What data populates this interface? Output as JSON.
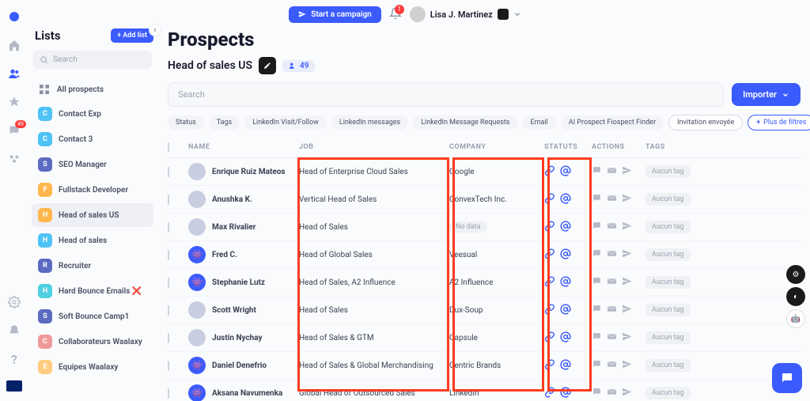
{
  "topbar": {
    "start_campaign": "Start a campaign",
    "notif_count": "1",
    "user_name": "Lisa J. Martinez"
  },
  "sidebar_nav": {
    "msgs_badge": "49"
  },
  "lists": {
    "title": "Lists",
    "add": "+  Add list",
    "search_placeholder": "Search",
    "all_prospects": "All prospects",
    "items": [
      {
        "initial": "C",
        "color": "#4fc3f7",
        "label": "Contact Exp"
      },
      {
        "initial": "C",
        "color": "#4fc3f7",
        "label": "Contact 3"
      },
      {
        "initial": "S",
        "color": "#5c6bc0",
        "label": "SEO Manager"
      },
      {
        "initial": "F",
        "color": "#ffb74d",
        "label": "Fullstack Developer"
      },
      {
        "initial": "H",
        "color": "#ffb74d",
        "label": "Head of sales US"
      },
      {
        "initial": "H",
        "color": "#4fc3f7",
        "label": "Head of sales"
      },
      {
        "initial": "R",
        "color": "#5c6bc0",
        "label": "Recruiter"
      },
      {
        "initial": "H",
        "color": "#4dd0e1",
        "label": "Hard Bounce Emails ❌"
      },
      {
        "initial": "S",
        "color": "#5c6bc0",
        "label": "Soft Bounce Camp1"
      },
      {
        "initial": "C",
        "color": "#ef9a9a",
        "label": "Collaborateurs Waalaxy"
      },
      {
        "initial": "E",
        "color": "#ffcc80",
        "label": "Equipes Waalaxy"
      }
    ]
  },
  "main": {
    "title": "Prospects",
    "subtitle": "Head of sales US",
    "count": "49",
    "search_placeholder": "Search",
    "import_btn": "Importer",
    "filters": [
      "Status",
      "Tags",
      "LinkedIn Visit/Follow",
      "LinkedIn messages",
      "LinkedIn Message Requests",
      "Email",
      "AI Prospect Fiospect Finder",
      "Invitation envoyée"
    ],
    "more_filters": "Plus de filtres",
    "columns": {
      "name": "NAME",
      "job": "JOB",
      "company": "COMPANY",
      "statuts": "STATUTS",
      "actions": "ACTIONS",
      "tags": "TAGS"
    },
    "no_data": "No data",
    "tag_default": "Aucun tag",
    "rows": [
      {
        "name": "Enrique Ruiz Mateos",
        "job": "Head of Enterprise Cloud Sales",
        "company": "Google",
        "alien": false
      },
      {
        "name": "Anushka K.",
        "job": "Vertical Head of Sales",
        "company": "ConvexTech Inc.",
        "alien": false
      },
      {
        "name": "Max Rivalier",
        "job": "Head of Sales",
        "company": "",
        "alien": false
      },
      {
        "name": "Fred C.",
        "job": "Head of Global Sales",
        "company": "Veesual",
        "alien": true
      },
      {
        "name": "Stephanie Lutz",
        "job": "Head of Sales, A2 Influence",
        "company": "A2 Influence",
        "alien": true
      },
      {
        "name": "Scott Wright",
        "job": "Head of Sales",
        "company": "Dux-Soup",
        "alien": false
      },
      {
        "name": "Justin Nychay",
        "job": "Head of Sales & GTM",
        "company": "Capsule",
        "alien": false
      },
      {
        "name": "Daniel Denefrio",
        "job": "Head of Sales & Global Merchandising",
        "company": "Centric Brands",
        "alien": true
      },
      {
        "name": "Aksana Navumenka",
        "job": "Global Head of Outsourced Sales",
        "company": "LinkedIn",
        "alien": true
      }
    ]
  }
}
